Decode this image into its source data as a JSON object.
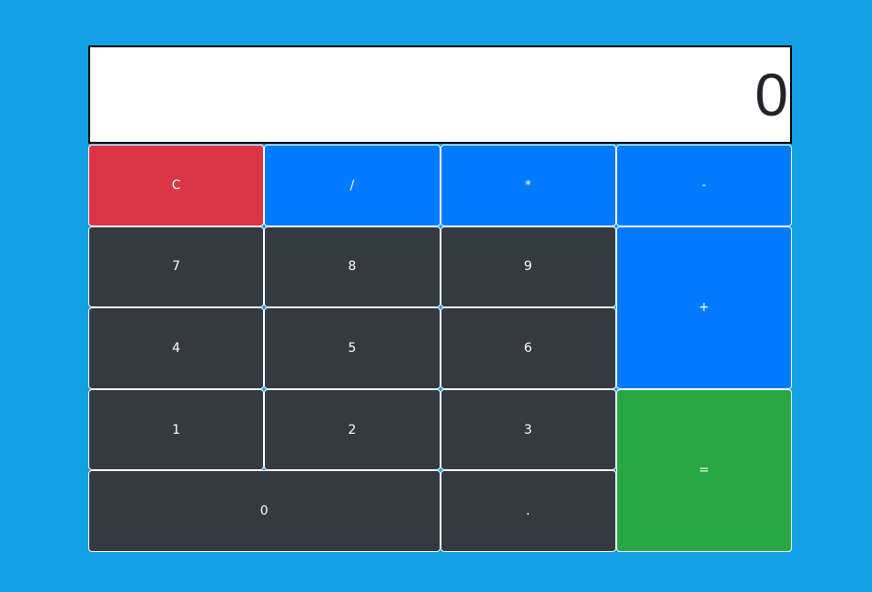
{
  "display": {
    "value": "0"
  },
  "buttons": {
    "clear": "C",
    "divide": "/",
    "multiply": "*",
    "subtract": "-",
    "seven": "7",
    "eight": "8",
    "nine": "9",
    "add": "+",
    "four": "4",
    "five": "5",
    "six": "6",
    "one": "1",
    "two": "2",
    "three": "3",
    "equals": "=",
    "zero": "0",
    "decimal": "."
  },
  "colors": {
    "background": "#14a0e4",
    "number": "#343a40",
    "operator": "#007bff",
    "clear": "#dc3545",
    "equals": "#28a745"
  }
}
